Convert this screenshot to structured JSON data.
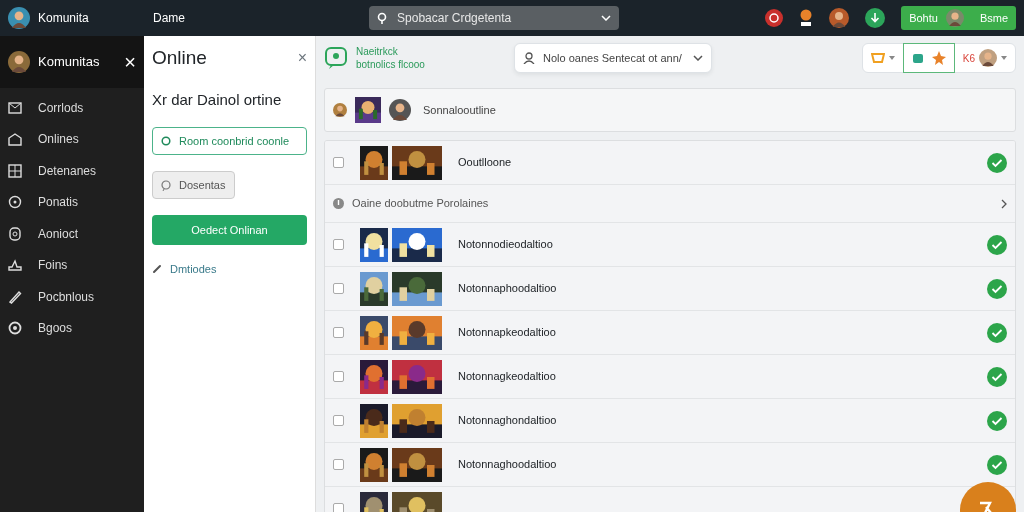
{
  "topbar": {
    "brand": "Komunita",
    "menu": "Dame",
    "search": "Spobacar Crdgetenta",
    "action": {
      "label": "Bohtu",
      "user": "Bsme"
    }
  },
  "sidebar": {
    "title": "Komunitas",
    "close": "×",
    "items": [
      {
        "label": "Corrlods"
      },
      {
        "label": "Onlines"
      },
      {
        "label": "Detenanes"
      },
      {
        "label": "Ponatis"
      },
      {
        "label": "Aonioct"
      },
      {
        "label": "Foins"
      },
      {
        "label": "Pocbnlous"
      },
      {
        "label": "Bgoos"
      }
    ]
  },
  "panel": {
    "title": "Online",
    "close": "×",
    "heading": "Xr dar Dainol ortine",
    "buttons": [
      {
        "kind": "outline",
        "label": "Room coonbrid coonle"
      },
      {
        "kind": "light",
        "label": "Dosentas"
      },
      {
        "kind": "primary",
        "label": "Oedect Onlinan"
      }
    ],
    "link": "Dmtiodes"
  },
  "main": {
    "title": [
      "Naeitrkck",
      "botnolics flcooo"
    ],
    "filter": "Nolo oanes Sentecat ot ann/",
    "badge": "K6",
    "summary": "Sonnalooutline",
    "rows": [
      {
        "kind": "item",
        "checked": false,
        "name": "Ooutlloone",
        "done": true
      },
      {
        "kind": "notice",
        "text": "Oaine doobutme Porolaines"
      },
      {
        "kind": "item",
        "checked": false,
        "name": "Notonnodieodaltioo",
        "done": true
      },
      {
        "kind": "item",
        "checked": false,
        "name": "Notonnaphoodaltioo",
        "done": true
      },
      {
        "kind": "item",
        "checked": false,
        "name": "Notonnapkeodaltioo",
        "done": true
      },
      {
        "kind": "item",
        "checked": false,
        "name": "Notonnagkeodaltioo",
        "done": true
      },
      {
        "kind": "item",
        "checked": false,
        "name": "Notonnaghondaltioo",
        "done": true
      },
      {
        "kind": "item",
        "checked": false,
        "name": "Notonnaghoodaltioo",
        "done": true
      },
      {
        "kind": "item",
        "checked": false
      }
    ]
  }
}
